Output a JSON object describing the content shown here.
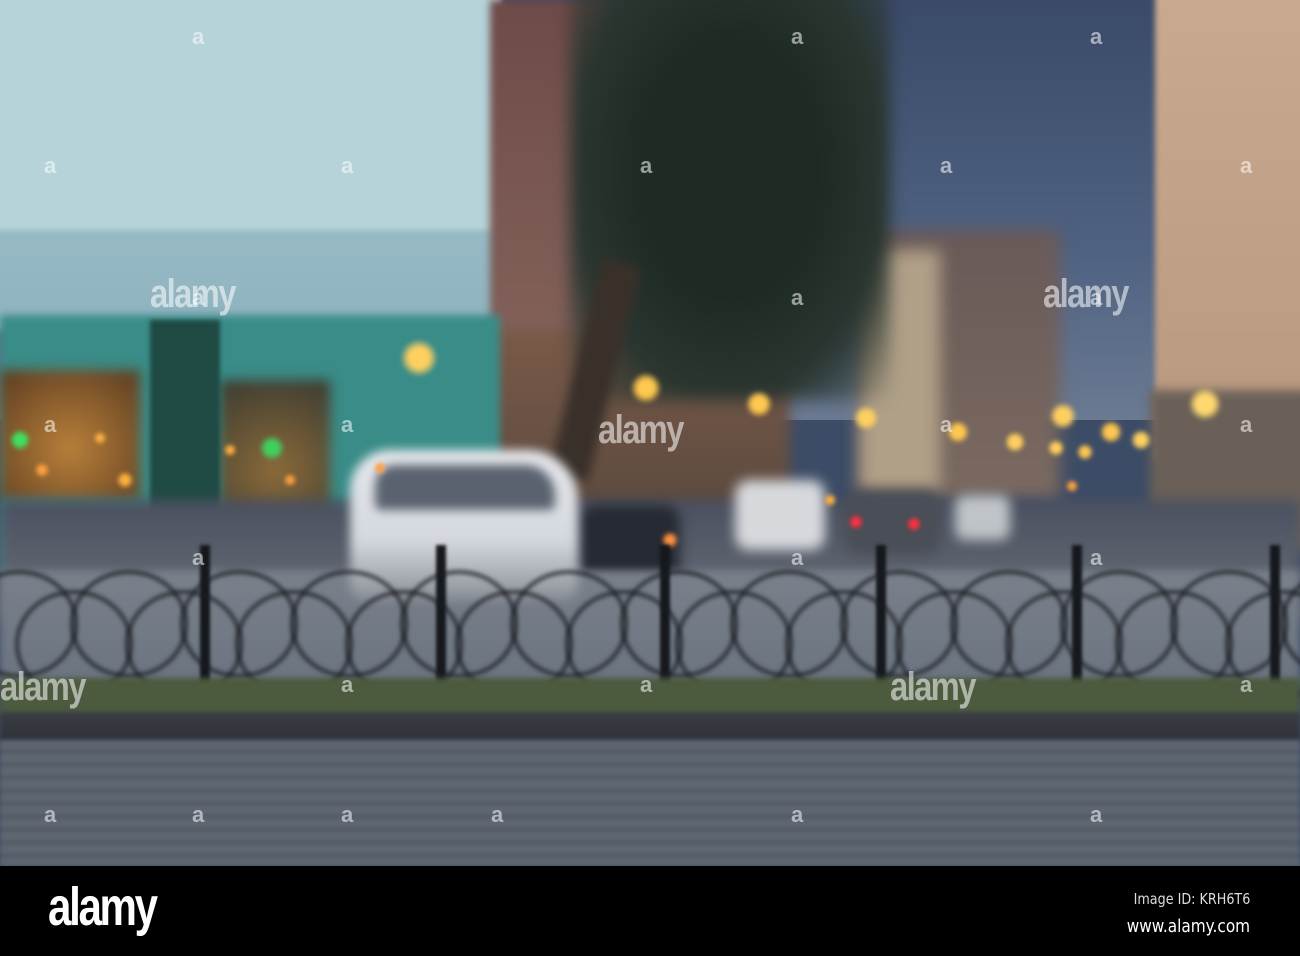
{
  "watermark": {
    "text": "alamy",
    "mark": "a"
  },
  "footer": {
    "logo": "alamy",
    "image_id": "Image ID: KRH6T6",
    "url": "www.alamy.com"
  },
  "colors": {
    "sky": "#4f6282",
    "lamp": "#ffc040",
    "building": "#a9cbd3",
    "cobblestone": "#5e6672"
  }
}
